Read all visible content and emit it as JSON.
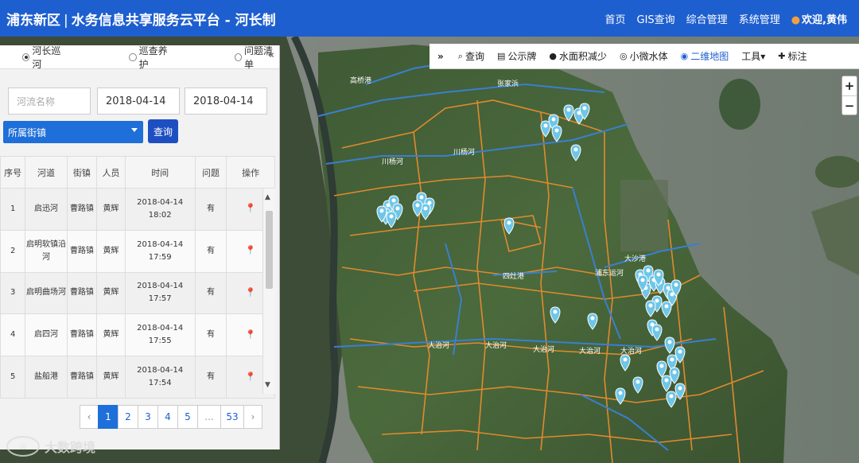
{
  "header": {
    "brand": "浦东新区",
    "separator": "|",
    "subtitle": "水务信息共享服务云平台 - 河长制",
    "nav": [
      "首页",
      "GIS查询",
      "综合管理",
      "系统管理"
    ],
    "welcome": "欢迎,黄伟"
  },
  "toolbar": {
    "collapse": "»",
    "items": [
      {
        "label": "查询",
        "icon": "search-icon"
      },
      {
        "label": "公示牌",
        "icon": "calendar-icon"
      },
      {
        "label": "水面积减少",
        "icon": "drop-icon"
      },
      {
        "label": "小微水体",
        "icon": "target-icon"
      },
      {
        "label": "二维地图",
        "icon": "globe-icon"
      },
      {
        "label": "工具▾",
        "icon": ""
      },
      {
        "label": "标注",
        "icon": "marker-icon"
      }
    ]
  },
  "zoom": {
    "in": "+",
    "out": "−"
  },
  "panel": {
    "tabs": [
      "河长巡河",
      "巡查养护",
      "问题清单"
    ],
    "collapse": "«",
    "river_placeholder": "河流名称",
    "date_start": "2018-04-14",
    "date_end": "2018-04-14",
    "district_label": "所属街镇",
    "query_label": "查询",
    "columns": [
      "序号",
      "河道",
      "街镇",
      "人员",
      "时间",
      "问题",
      "操作"
    ],
    "rows": [
      {
        "no": "1",
        "river": "启迅河",
        "town": "曹路镇",
        "person": "黄辉",
        "time": "2018-04-14 18:02",
        "issue": "有"
      },
      {
        "no": "2",
        "river": "启明软镇沿河",
        "town": "曹路镇",
        "person": "黄辉",
        "time": "2018-04-14 17:59",
        "issue": "有"
      },
      {
        "no": "3",
        "river": "启明曲场河",
        "town": "曹路镇",
        "person": "黄辉",
        "time": "2018-04-14 17:57",
        "issue": "有"
      },
      {
        "no": "4",
        "river": "启四河",
        "town": "曹路镇",
        "person": "黄辉",
        "time": "2018-04-14 17:55",
        "issue": "有"
      },
      {
        "no": "5",
        "river": "盐船港",
        "town": "曹路镇",
        "person": "黄辉",
        "time": "2018-04-14 17:54",
        "issue": "有"
      }
    ],
    "pager": {
      "prev": "‹",
      "pages": [
        "1",
        "2",
        "3",
        "4",
        "5"
      ],
      "dots": "...",
      "last": "53",
      "next": "›"
    }
  },
  "map_labels": [
    "高桥港",
    "张家浜",
    "川杨河",
    "川杨河",
    "四灶港",
    "大沙港",
    "大治河",
    "大治河",
    "大治河",
    "大治河",
    "大治河",
    "浦东运河"
  ],
  "watermark": "大数跨境",
  "colors": {
    "header": "#1e5fcf",
    "accent": "#1e6fd9",
    "boundary": "#e08a2e",
    "river": "#3a7fd0",
    "pin": "#6ec6e8"
  }
}
